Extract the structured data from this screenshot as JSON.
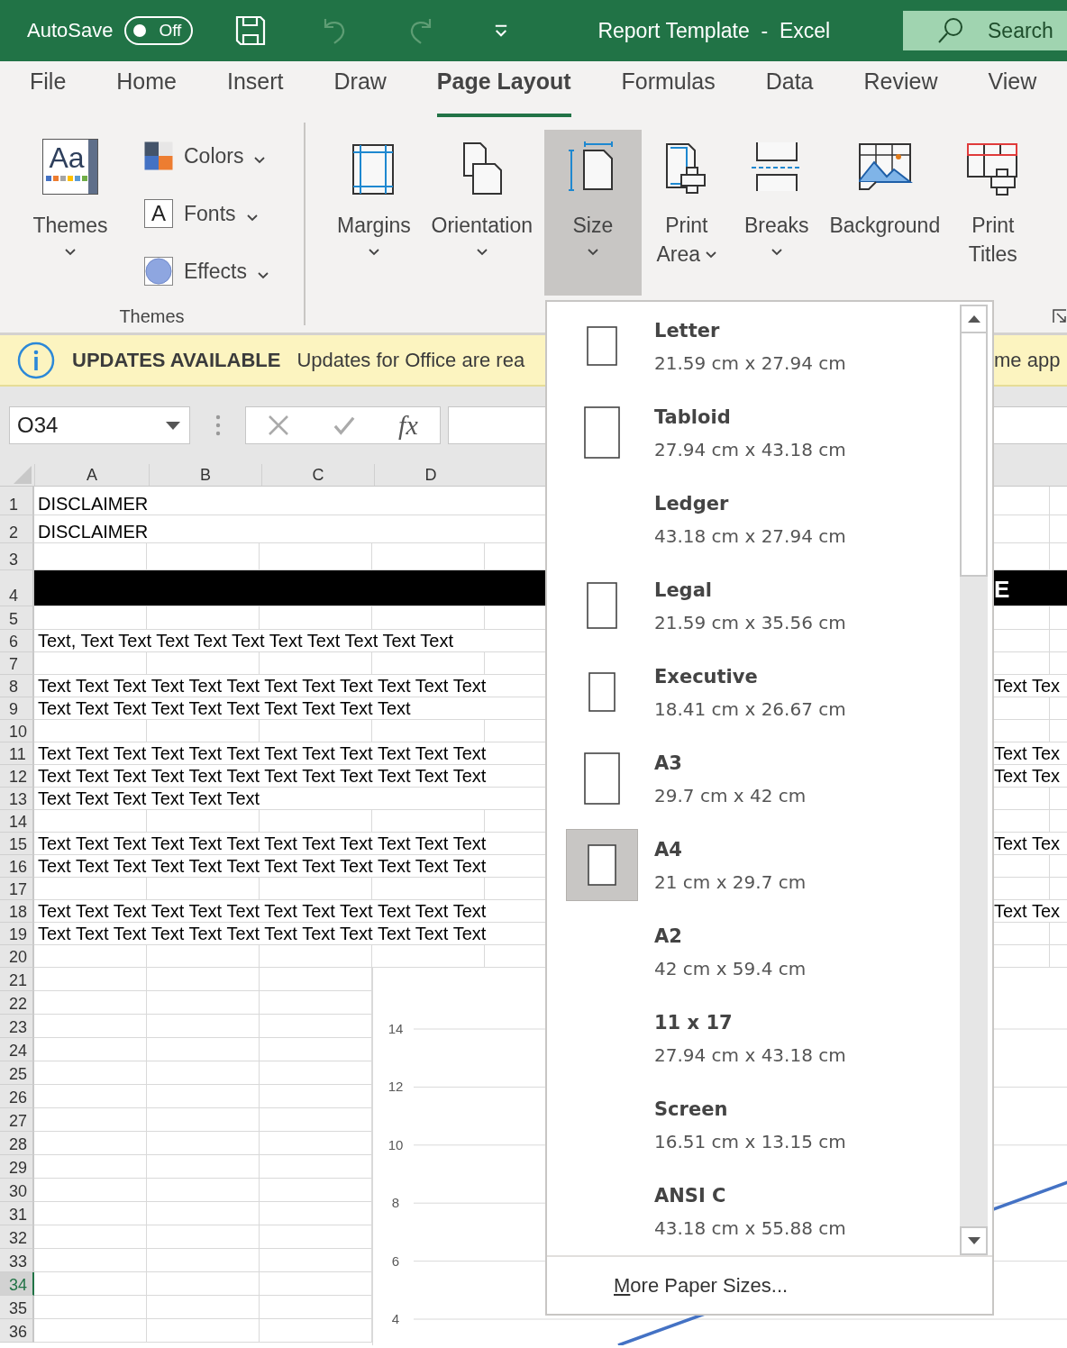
{
  "title_bar": {
    "autosave_label": "AutoSave",
    "autosave": {
      "on": false,
      "text": "Off"
    },
    "quick_access": [
      {
        "kind": "save",
        "disabled": false
      },
      {
        "kind": "undo",
        "disabled": true
      },
      {
        "kind": "redo",
        "disabled": true
      },
      {
        "kind": "customize",
        "disabled": false
      }
    ],
    "title": "Report Template  -  Excel",
    "search": {
      "label": "Search"
    }
  },
  "tabs": [
    {
      "label": "File",
      "selected": false
    },
    {
      "label": "Home",
      "selected": false
    },
    {
      "label": "Insert",
      "selected": false
    },
    {
      "label": "Draw",
      "selected": false
    },
    {
      "label": "Page Layout",
      "selected": true
    },
    {
      "label": "Formulas",
      "selected": false
    },
    {
      "label": "Data",
      "selected": false
    },
    {
      "label": "Review",
      "selected": false
    },
    {
      "label": "View",
      "selected": false
    }
  ],
  "themes_group": {
    "label": "Themes",
    "button": {
      "label": "Themes",
      "icon_text": "Aa",
      "menu": true
    },
    "small_buttons": [
      {
        "kind": "colors",
        "label": "Colors",
        "menu": true
      },
      {
        "kind": "fonts",
        "label": "Fonts",
        "menu": true,
        "icon_text": "A"
      },
      {
        "kind": "effects",
        "label": "Effects",
        "menu": true
      }
    ]
  },
  "page_setup_group": {
    "buttons": [
      {
        "kind": "margins",
        "lines": [
          "Margins"
        ],
        "menu": true,
        "selected": false
      },
      {
        "kind": "orientation",
        "lines": [
          "Orientation"
        ],
        "menu": true,
        "selected": false
      },
      {
        "kind": "size",
        "lines": [
          "Size"
        ],
        "menu": true,
        "selected": true
      },
      {
        "kind": "print_area",
        "lines": [
          "Print",
          "Area"
        ],
        "menu": true,
        "selected": false
      },
      {
        "kind": "breaks",
        "lines": [
          "Breaks"
        ],
        "menu": true,
        "selected": false
      },
      {
        "kind": "background",
        "lines": [
          "Background"
        ],
        "menu": false,
        "selected": false
      },
      {
        "kind": "print_titles",
        "lines": [
          "Print",
          "Titles"
        ],
        "menu": false,
        "selected": false
      }
    ]
  },
  "notification": {
    "title": "UPDATES AVAILABLE",
    "message": "Updates for Office are rea",
    "message_tail": "me app"
  },
  "formula_bar": {
    "name_box": "O34",
    "function_label": "fx"
  },
  "sheet": {
    "columns": [
      "A",
      "B",
      "C",
      "D"
    ],
    "rows": [
      {
        "header": "1",
        "selected": false,
        "text": "DISCLAIMER"
      },
      {
        "header": "2",
        "selected": false,
        "text": "DISCLAIMER"
      },
      {
        "header": "3",
        "selected": false
      },
      {
        "header": "4",
        "selected": false,
        "kind": "band",
        "right_text": "E"
      },
      {
        "header": "5",
        "selected": false
      },
      {
        "header": "6",
        "selected": false,
        "text": "Text, Text Text Text Text Text Text Text Text Text Text"
      },
      {
        "header": "7",
        "selected": false
      },
      {
        "header": "8",
        "selected": false,
        "text": "Text Text Text Text Text Text Text Text Text Text Text Text",
        "right_text": "Text Tex"
      },
      {
        "header": "9",
        "selected": false,
        "text": "Text Text Text Text Text Text Text Text Text Text"
      },
      {
        "header": "10",
        "selected": false
      },
      {
        "header": "11",
        "selected": false,
        "text": "Text Text Text Text Text Text Text Text Text Text Text Text",
        "right_text": "Text Tex"
      },
      {
        "header": "12",
        "selected": false,
        "text": "Text Text Text Text Text Text Text Text Text Text Text Text",
        "right_text": "Text Tex"
      },
      {
        "header": "13",
        "selected": false,
        "text": "Text Text Text Text Text Text"
      },
      {
        "header": "14",
        "selected": false
      },
      {
        "header": "15",
        "selected": false,
        "text": "Text Text Text Text Text Text Text Text Text Text Text Text",
        "right_text": "Text Tex"
      },
      {
        "header": "16",
        "selected": false,
        "text": "Text Text Text Text Text Text Text Text Text Text Text Text"
      },
      {
        "header": "17",
        "selected": false
      },
      {
        "header": "18",
        "selected": false,
        "text": "Text Text Text Text Text Text Text Text Text Text Text Text",
        "right_text": "Text Tex"
      },
      {
        "header": "19",
        "selected": false,
        "text": "Text Text Text Text Text Text Text Text Text Text Text Text"
      },
      {
        "header": "20",
        "selected": false
      },
      {
        "header": "21",
        "selected": false
      },
      {
        "header": "22",
        "selected": false
      },
      {
        "header": "23",
        "selected": false
      },
      {
        "header": "24",
        "selected": false
      },
      {
        "header": "25",
        "selected": false
      },
      {
        "header": "26",
        "selected": false
      },
      {
        "header": "27",
        "selected": false
      },
      {
        "header": "28",
        "selected": false
      },
      {
        "header": "29",
        "selected": false
      },
      {
        "header": "30",
        "selected": false
      },
      {
        "header": "31",
        "selected": false
      },
      {
        "header": "32",
        "selected": false
      },
      {
        "header": "33",
        "selected": false
      },
      {
        "header": "34",
        "selected": true
      },
      {
        "header": "35",
        "selected": false
      },
      {
        "header": "36",
        "selected": false
      }
    ]
  },
  "chart": {
    "ytick_labels": [
      "14",
      "12",
      "10",
      "8",
      "6",
      "4"
    ]
  },
  "size_menu": {
    "items": [
      {
        "name": "Letter",
        "dimensions": "21.59 cm x 27.94 cm",
        "kind": "small",
        "selected": false
      },
      {
        "name": "Tabloid",
        "dimensions": "27.94 cm x 43.18 cm",
        "kind": "large",
        "selected": false
      },
      {
        "name": "Ledger",
        "dimensions": "43.18 cm x 27.94 cm",
        "kind": "none",
        "selected": false
      },
      {
        "name": "Legal",
        "dimensions": "21.59 cm x 35.56 cm",
        "kind": "tall",
        "selected": false
      },
      {
        "name": "Executive",
        "dimensions": "18.41 cm x 26.67 cm",
        "kind": "narrow",
        "selected": false
      },
      {
        "name": "A3",
        "dimensions": "29.7 cm x 42 cm",
        "kind": "large",
        "selected": false
      },
      {
        "name": "A4",
        "dimensions": "21 cm x 29.7 cm",
        "kind": "medium",
        "selected": true
      },
      {
        "name": "A2",
        "dimensions": "42 cm x 59.4 cm",
        "kind": "none",
        "selected": false
      },
      {
        "name": "11 x 17",
        "dimensions": "27.94 cm x 43.18 cm",
        "kind": "none",
        "selected": false
      },
      {
        "name": "Screen",
        "dimensions": "16.51 cm x 13.15 cm",
        "kind": "none",
        "selected": false
      },
      {
        "name": "ANSI C",
        "dimensions": "43.18 cm x 55.88 cm",
        "kind": "none",
        "selected": false
      }
    ],
    "more": {
      "label": "More Paper Sizes..."
    }
  }
}
